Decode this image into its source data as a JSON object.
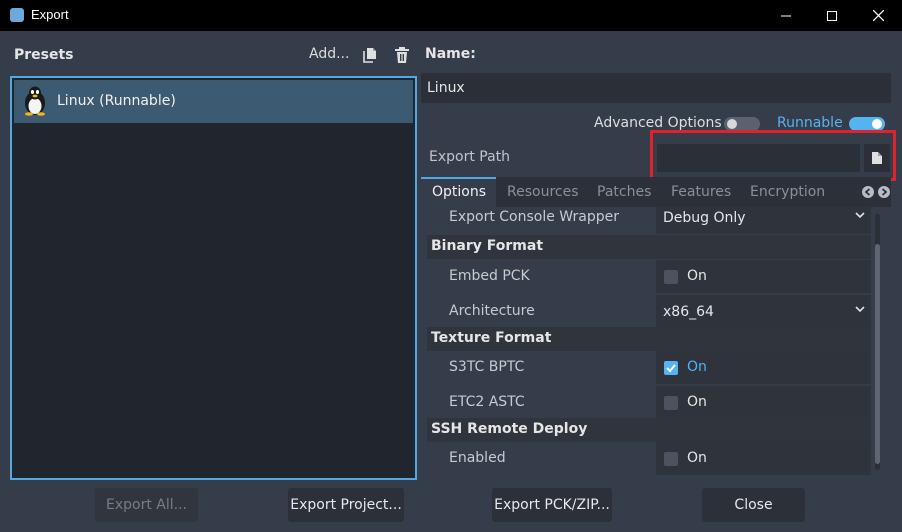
{
  "window": {
    "title": "Export",
    "controls": [
      "minimize",
      "maximize",
      "close"
    ]
  },
  "presets": {
    "label": "Presets",
    "add_label": "Add...",
    "items": [
      {
        "label": "Linux (Runnable)",
        "icon": "linux-tux-icon"
      }
    ]
  },
  "details": {
    "name_label": "Name:",
    "name_value": "Linux",
    "advanced_options_label": "Advanced Options",
    "advanced_options_enabled": false,
    "runnable_label": "Runnable",
    "runnable_enabled": true,
    "export_path_label": "Export Path",
    "export_path_value": ""
  },
  "tabs": [
    "Options",
    "Resources",
    "Patches",
    "Features",
    "Encryption"
  ],
  "options": {
    "export_console_wrapper": {
      "label": "Export Console Wrapper",
      "value": "Debug Only"
    },
    "binary_format": {
      "title": "Binary Format",
      "embed_pck": {
        "label": "Embed PCK",
        "checked": false,
        "text": "On"
      },
      "architecture": {
        "label": "Architecture",
        "value": "x86_64"
      }
    },
    "texture_format": {
      "title": "Texture Format",
      "s3tc_bptc": {
        "label": "S3TC BPTC",
        "checked": true,
        "text": "On"
      },
      "etc2_astc": {
        "label": "ETC2 ASTC",
        "checked": false,
        "text": "On"
      }
    },
    "ssh_remote_deploy": {
      "title": "SSH Remote Deploy",
      "enabled": {
        "label": "Enabled",
        "checked": false,
        "text": "On"
      }
    }
  },
  "footer": {
    "export_all": "Export All...",
    "export_project": "Export Project...",
    "export_pck_zip": "Export PCK/ZIP...",
    "close": "Close"
  },
  "colors": {
    "accent": "#53a8e3",
    "highlight_box": "#e3212b",
    "panel_bg": "#363d4a",
    "list_bg": "#21252d"
  }
}
